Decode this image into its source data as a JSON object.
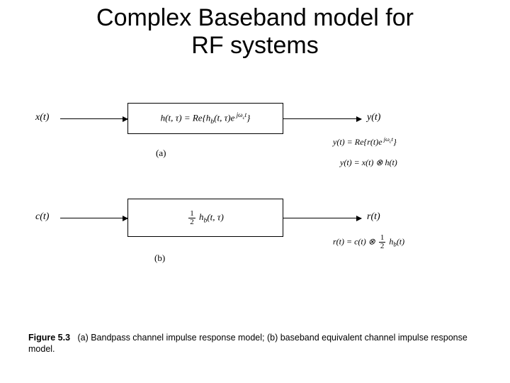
{
  "title_line1": "Complex Baseband model for",
  "title_line2": "RF systems",
  "diagram_a": {
    "input": "x(t)",
    "block": "h(t, τ) = Re{h_b(t, τ) e^{jω_c t}}",
    "output": "y(t)",
    "label": "(a)",
    "eq1": "y(t) = Re{r(t) e^{jω_c t}}",
    "eq2": "y(t) = x(t) ⊗ h(t)"
  },
  "diagram_b": {
    "input": "c(t)",
    "block_prefix": "½",
    "block_core": "h_b(t, τ)",
    "output": "r(t)",
    "label": "(b)",
    "eq1": "r(t) = c(t) ⊗ ½ h_b(t)"
  },
  "caption": {
    "fig": "Figure 5.3",
    "text": "(a) Bandpass channel impulse response model; (b) baseband equivalent channel impulse response model."
  }
}
